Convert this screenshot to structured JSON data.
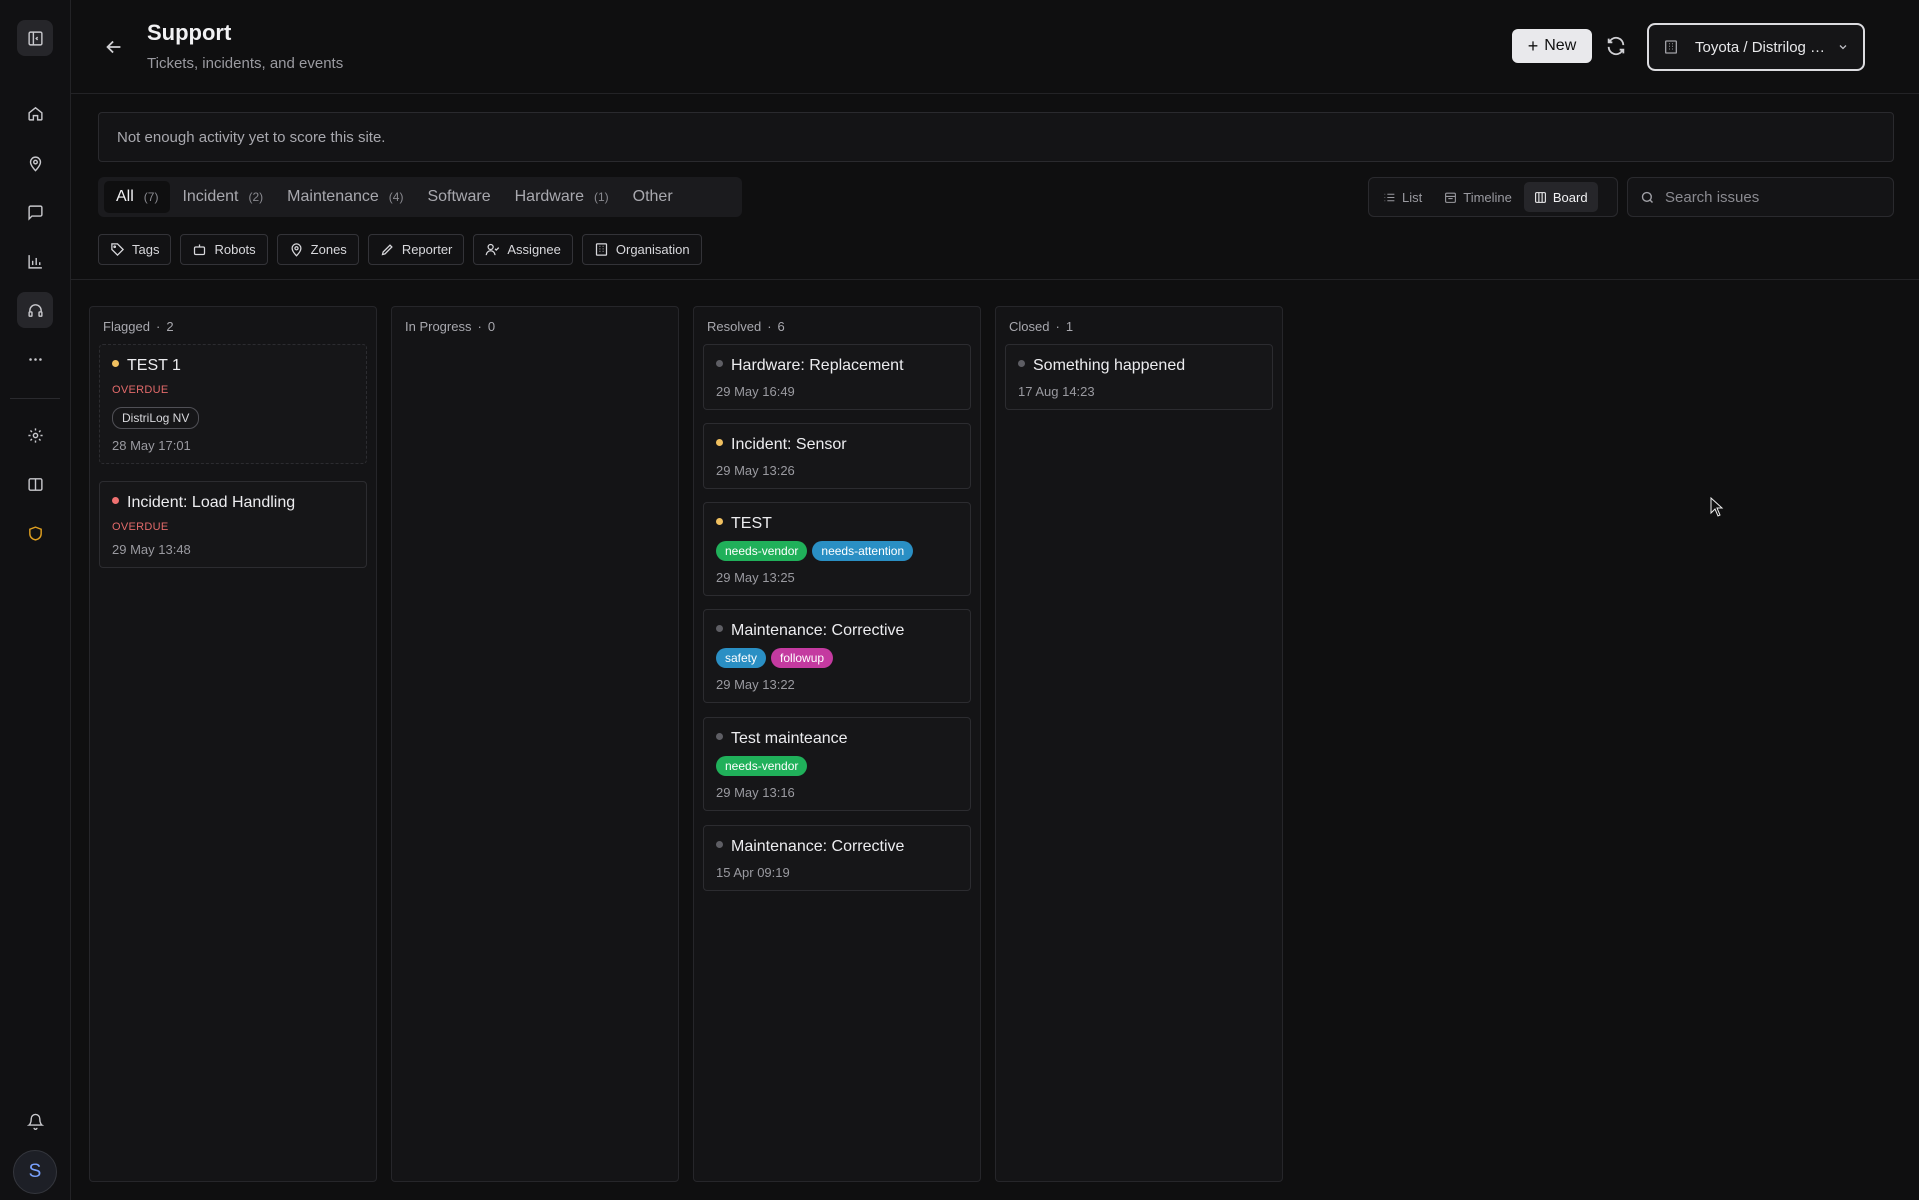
{
  "header": {
    "title": "Support",
    "subtitle": "Tickets, incidents, and events",
    "new_label": "New",
    "org_selector": "Toyota / Distrilog —..."
  },
  "banner": {
    "text": "Not enough activity yet to score this site."
  },
  "category_tabs": [
    {
      "label": "All",
      "count": "(7)",
      "active": true
    },
    {
      "label": "Incident",
      "count": "(2)"
    },
    {
      "label": "Maintenance",
      "count": "(4)"
    },
    {
      "label": "Software",
      "count": ""
    },
    {
      "label": "Hardware",
      "count": "(1)"
    },
    {
      "label": "Other",
      "count": ""
    }
  ],
  "view_modes": [
    {
      "label": "List",
      "icon": "list-icon"
    },
    {
      "label": "Timeline",
      "icon": "calendar-icon"
    },
    {
      "label": "Board",
      "icon": "columns-icon",
      "active": true
    }
  ],
  "search": {
    "placeholder": "Search issues"
  },
  "filters": [
    {
      "label": "Tags",
      "icon": "tag-icon"
    },
    {
      "label": "Robots",
      "icon": "robot-icon"
    },
    {
      "label": "Zones",
      "icon": "pin-icon"
    },
    {
      "label": "Reporter",
      "icon": "pen-icon"
    },
    {
      "label": "Assignee",
      "icon": "user-check-icon"
    },
    {
      "label": "Organisation",
      "icon": "building-icon"
    }
  ],
  "colors": {
    "needs_vendor": "#20b05a",
    "needs_attention": "#2a8fc4",
    "safety": "#2a8fc4",
    "followup": "#c43aa0",
    "overdue": "#e26a6a",
    "dot_yellow": "#f0c060",
    "dot_red": "#f07171"
  },
  "board": {
    "columns": [
      {
        "name": "Flagged",
        "count": "2",
        "cards": [
          {
            "title": "TEST 1",
            "status_dot": "yellow",
            "overdue": "OVERDUE",
            "org": "DistriLog NV",
            "date": "28 May 17:01"
          },
          {
            "title": "Incident: Load Handling",
            "status_dot": "red",
            "overdue": "OVERDUE",
            "date": "29 May 13:48"
          }
        ]
      },
      {
        "name": "In Progress",
        "count": "0",
        "cards": []
      },
      {
        "name": "Resolved",
        "count": "6",
        "cards": [
          {
            "title": "Hardware: Replacement",
            "status_dot": "gray",
            "date": "29 May 16:49"
          },
          {
            "title": "Incident: Sensor",
            "status_dot": "yellow",
            "date": "29 May 13:26"
          },
          {
            "title": "TEST",
            "status_dot": "yellow",
            "tags": [
              "needs-vendor",
              "needs-attention"
            ],
            "date": "29 May 13:25"
          },
          {
            "title": "Maintenance: Corrective",
            "status_dot": "gray",
            "tags": [
              "safety",
              "followup"
            ],
            "date": "29 May 13:22"
          },
          {
            "title": "Test mainteance",
            "status_dot": "gray",
            "tags": [
              "needs-vendor"
            ],
            "date": "29 May 13:16"
          },
          {
            "title": "Maintenance: Corrective",
            "status_dot": "gray",
            "date": "15 Apr 09:19"
          }
        ]
      },
      {
        "name": "Closed",
        "count": "1",
        "cards": [
          {
            "title": "Something happened",
            "status_dot": "gray",
            "date": "17 Aug 14:23"
          }
        ]
      }
    ]
  },
  "sidebar": {
    "avatar_initial": "S"
  }
}
